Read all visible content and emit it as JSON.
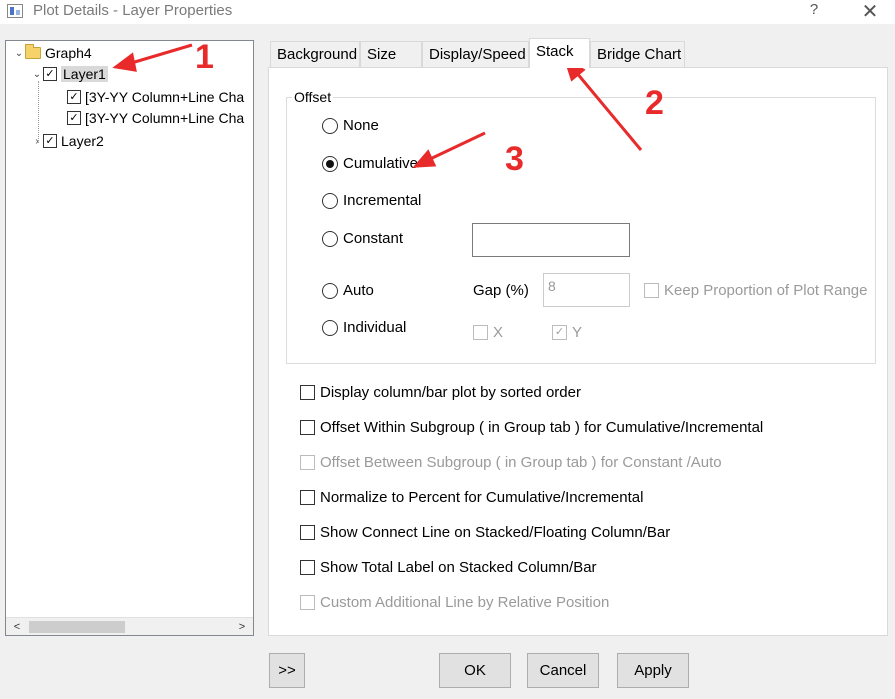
{
  "window": {
    "title": "Plot Details - Layer Properties",
    "help_glyph": "?",
    "close_glyph": "✕"
  },
  "tree": {
    "root": {
      "label": "Graph4",
      "expanded": true
    },
    "layer1": {
      "label": "Layer1",
      "checked": true,
      "selected": true
    },
    "plots": [
      {
        "label": "[3Y-YY Column+Line Cha",
        "checked": true
      },
      {
        "label": "[3Y-YY Column+Line Cha",
        "checked": true
      }
    ],
    "layer2": {
      "label": "Layer2",
      "checked": true
    }
  },
  "tabs": [
    {
      "label": "Background",
      "active": false
    },
    {
      "label": "Size",
      "active": false
    },
    {
      "label": "Display/Speed",
      "active": false
    },
    {
      "label": "Stack",
      "active": true
    },
    {
      "label": "Bridge Chart",
      "active": false
    }
  ],
  "offset": {
    "group_label": "Offset",
    "options": [
      {
        "label": "None",
        "selected": false
      },
      {
        "label": "Cumulative",
        "selected": true
      },
      {
        "label": "Incremental",
        "selected": false
      },
      {
        "label": "Constant",
        "selected": false
      },
      {
        "label": "Auto",
        "selected": false
      },
      {
        "label": "Individual",
        "selected": false
      }
    ],
    "constant_value": "",
    "gap_label": "Gap (%)",
    "gap_value": "8",
    "keep_proportion_label": "Keep Proportion of Plot Range",
    "x_label": "X",
    "y_label": "Y",
    "x_checked": false,
    "y_checked": true
  },
  "options": [
    {
      "label": "Display column/bar plot by sorted order",
      "checked": false,
      "enabled": true
    },
    {
      "label": "Offset Within Subgroup ( in Group tab ) for Cumulative/Incremental",
      "checked": false,
      "enabled": true
    },
    {
      "label": "Offset Between Subgroup ( in Group tab ) for Constant /Auto",
      "checked": false,
      "enabled": false
    },
    {
      "label": "Normalize to Percent for Cumulative/Incremental",
      "checked": false,
      "enabled": true
    },
    {
      "label": "Show Connect Line on Stacked/Floating Column/Bar",
      "checked": false,
      "enabled": true
    },
    {
      "label": "Show Total Label on Stacked Column/Bar",
      "checked": false,
      "enabled": true
    },
    {
      "label": "Custom Additional Line by Relative Position",
      "checked": false,
      "enabled": false
    }
  ],
  "buttons": {
    "expand": ">>",
    "ok": "OK",
    "cancel": "Cancel",
    "apply": "Apply"
  },
  "scrollbar": {
    "left": "<",
    "right": ">"
  },
  "annotations": {
    "a1": "1",
    "a2": "2",
    "a3": "3"
  },
  "colors": {
    "annotation": "#e82a2a",
    "selection": "#d9d9d9"
  }
}
